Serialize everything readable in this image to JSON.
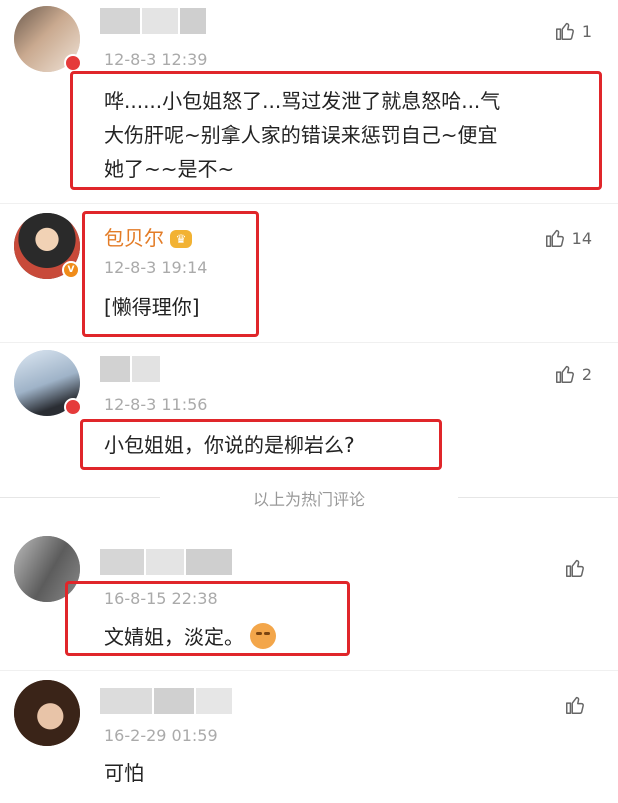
{
  "comments": [
    {
      "time": "12-8-3 12:39",
      "text_lines": [
        "哗......小包姐怒了...骂过发泄了就息怒哈...气",
        "大伤肝呢~别拿人家的错误来惩罚自己~便宜",
        "她了~~是不~"
      ],
      "likes": "1"
    },
    {
      "name": "包贝尔",
      "time": "12-8-3 19:14",
      "text": "[懒得理你]",
      "likes": "14"
    },
    {
      "time": "12-8-3 11:56",
      "text": "小包姐姐，你说的是柳岩么?",
      "likes": "2"
    },
    {
      "time": "16-8-15 22:38",
      "text": "文婧姐，淡定。",
      "likes": ""
    },
    {
      "time": "16-2-29 01:59",
      "text": "可怕",
      "likes": ""
    }
  ],
  "hot_divider": "以上为热门评论",
  "colors": {
    "highlight": "#e0262a",
    "name": "#e37c27",
    "time": "#aaaaaa"
  },
  "icons": {
    "like": "thumbs-up-icon",
    "emoji": "relieved-face-emoji"
  }
}
